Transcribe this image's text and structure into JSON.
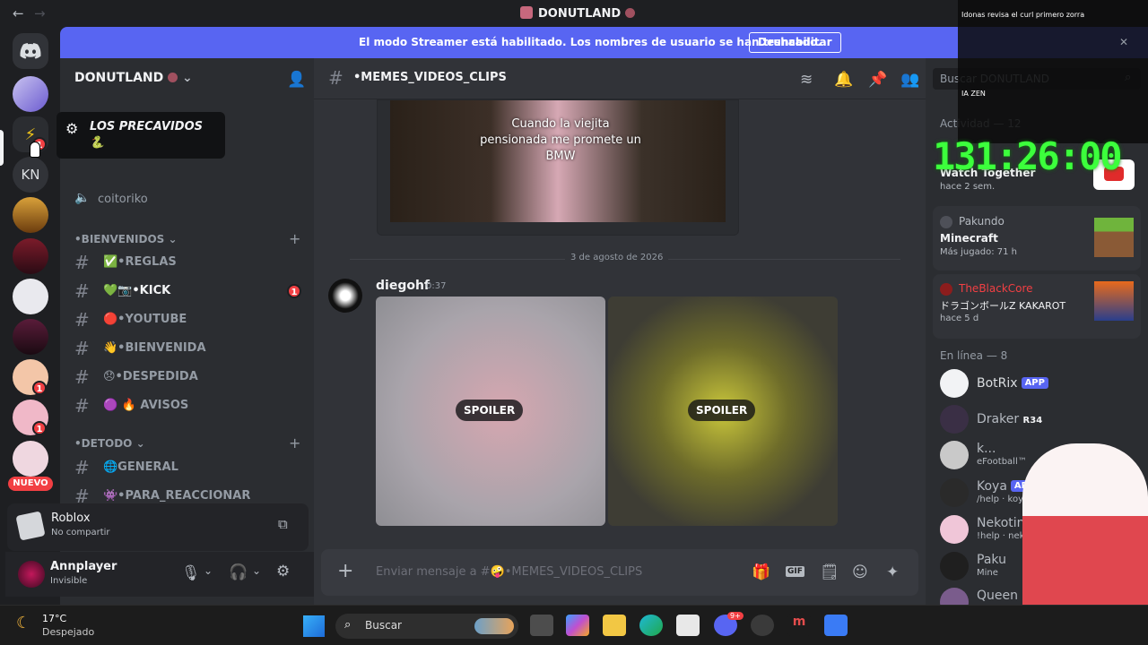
{
  "window": {
    "title": "DONUTLAND",
    "back_icon": "arrow-left-icon",
    "forward_icon": "arrow-right-icon"
  },
  "banner": {
    "text": "El modo Streamer está habilitado. Los nombres de usuario se han truncado.",
    "button": "Deshabilitar"
  },
  "guilds": {
    "new_badge": "NUEVO",
    "kn_label": "KN",
    "badge_count": "1"
  },
  "tooltip": {
    "name": "LOS PRECAVIDOS 🐍"
  },
  "server": {
    "name": "DONUTLAND"
  },
  "channels": {
    "voice": "coitoriko",
    "cat1": "•BIENVENIDOS",
    "items1": [
      {
        "label": "✅•REGLAS"
      },
      {
        "label": "💚📷•KICK",
        "unread": "1"
      },
      {
        "label": "🔴•YOUTUBE"
      },
      {
        "label": "👋•BIENVENIDA"
      },
      {
        "label": "😞•DESPEDIDA"
      },
      {
        "label": "🟣 🔥 AVISOS"
      }
    ],
    "cat2": "•DETODO",
    "items2": [
      {
        "label": "🌐GENERAL"
      },
      {
        "label": "👾•PARA_REACCIONAR"
      }
    ]
  },
  "activity": {
    "title": "Roblox",
    "subtitle": "No compartir"
  },
  "user": {
    "name": "Annplayer",
    "status": "Invisible"
  },
  "chat": {
    "channel": "•MEMES_VIDEOS_CLIPS",
    "video_caption": "Cuando la viejita pensionada me promete un BMW",
    "date_divider": "3 de agosto de 2026",
    "author": "diegohf",
    "time": "0:37",
    "spoiler_label": "SPOILER",
    "input_placeholder": "Enviar mensaje a #🤪•MEMES_VIDEOS_CLIPS",
    "search_placeholder": "Buscar DONUTLAND"
  },
  "members": {
    "activity_header": "Actividad — 12",
    "watch_title": "Watch Together",
    "watch_time": "hace 2 sem.",
    "card1": {
      "user": "Pakundo",
      "game": "Minecraft",
      "meta": "Más jugado: 71 h"
    },
    "card2": {
      "user": "TheBlackCore",
      "game": "ドラゴンボールZ KAKAROT",
      "meta": "hace 5 d"
    },
    "online_header": "En línea — 8",
    "list": [
      {
        "name": "BotRix",
        "tag": "APP",
        "status": ""
      },
      {
        "name": "Draker",
        "tag": "R34",
        "status": ""
      },
      {
        "name": "k...",
        "tag": "",
        "status": "eFootball™"
      },
      {
        "name": "Koya",
        "tag": "APP",
        "status": "/help · koya.g"
      },
      {
        "name": "Nekotina",
        "tag": "",
        "status": "!help · nek"
      },
      {
        "name": "Paku",
        "tag": "",
        "status": "Mine"
      },
      {
        "name": "Queen",
        "tag": "",
        "status": ""
      }
    ]
  },
  "overlay": {
    "timer": "131:26:00",
    "chat_line1": "Idonas revisa el curl primero zorra",
    "chat_line2": "IA ZEN"
  },
  "taskbar": {
    "temp": "17°C",
    "weather": "Despejado",
    "search": "Buscar",
    "discord_badge": "9+"
  }
}
